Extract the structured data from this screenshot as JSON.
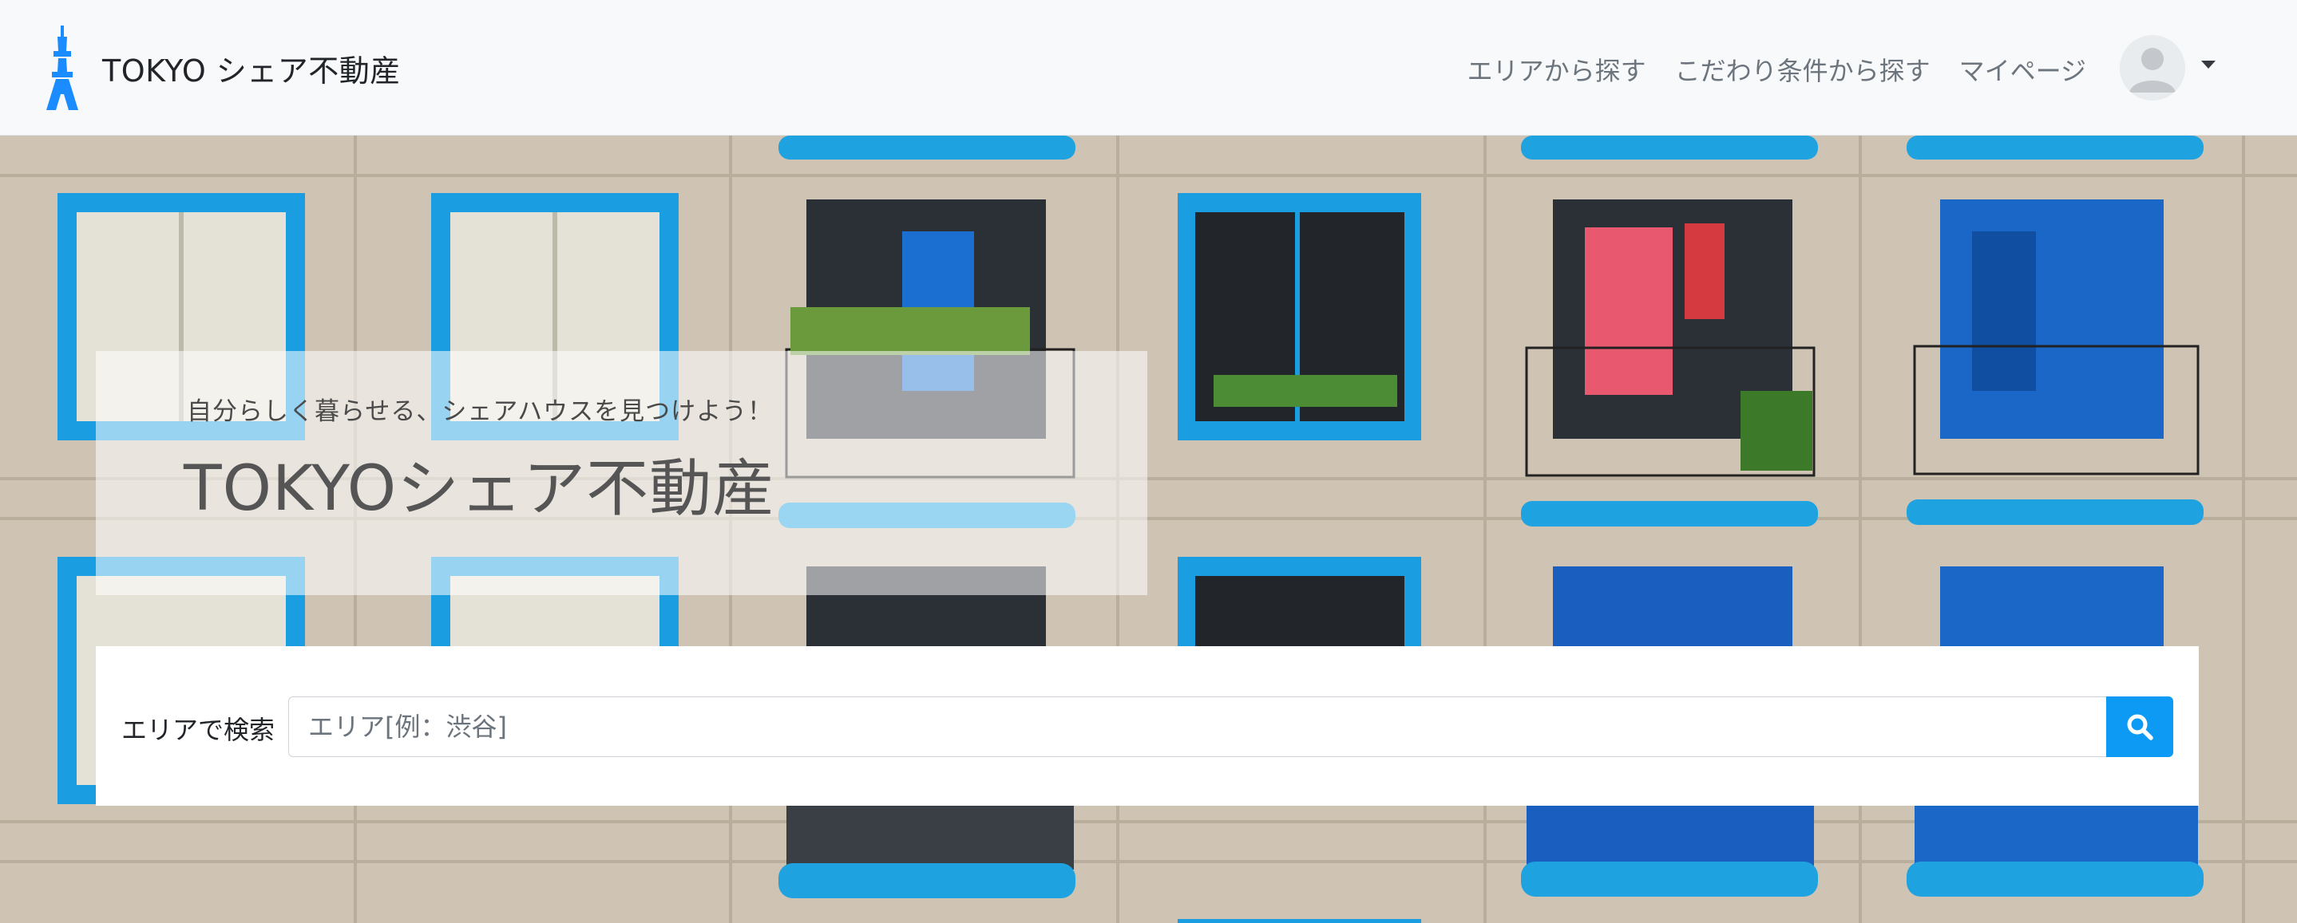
{
  "brand": {
    "name": "TOKYO シェア不動産",
    "logo_icon": "tokyo-tower-icon",
    "logo_color": "#1a8cff"
  },
  "nav": {
    "links": [
      {
        "label": "エリアから探す"
      },
      {
        "label": "こだわり条件から探す"
      },
      {
        "label": "マイページ"
      }
    ],
    "user_icon": "avatar-placeholder-icon"
  },
  "hero": {
    "tagline": "自分らしく暮らせる、シェアハウスを見つけよう！",
    "title": "TOKYOシェア不動産",
    "background": "apartment-balconies-photo"
  },
  "search": {
    "label": "エリアで検索",
    "placeholder": "エリア[例：渋谷]",
    "value": "",
    "button_icon": "search-icon",
    "button_color": "#0d9af5"
  }
}
